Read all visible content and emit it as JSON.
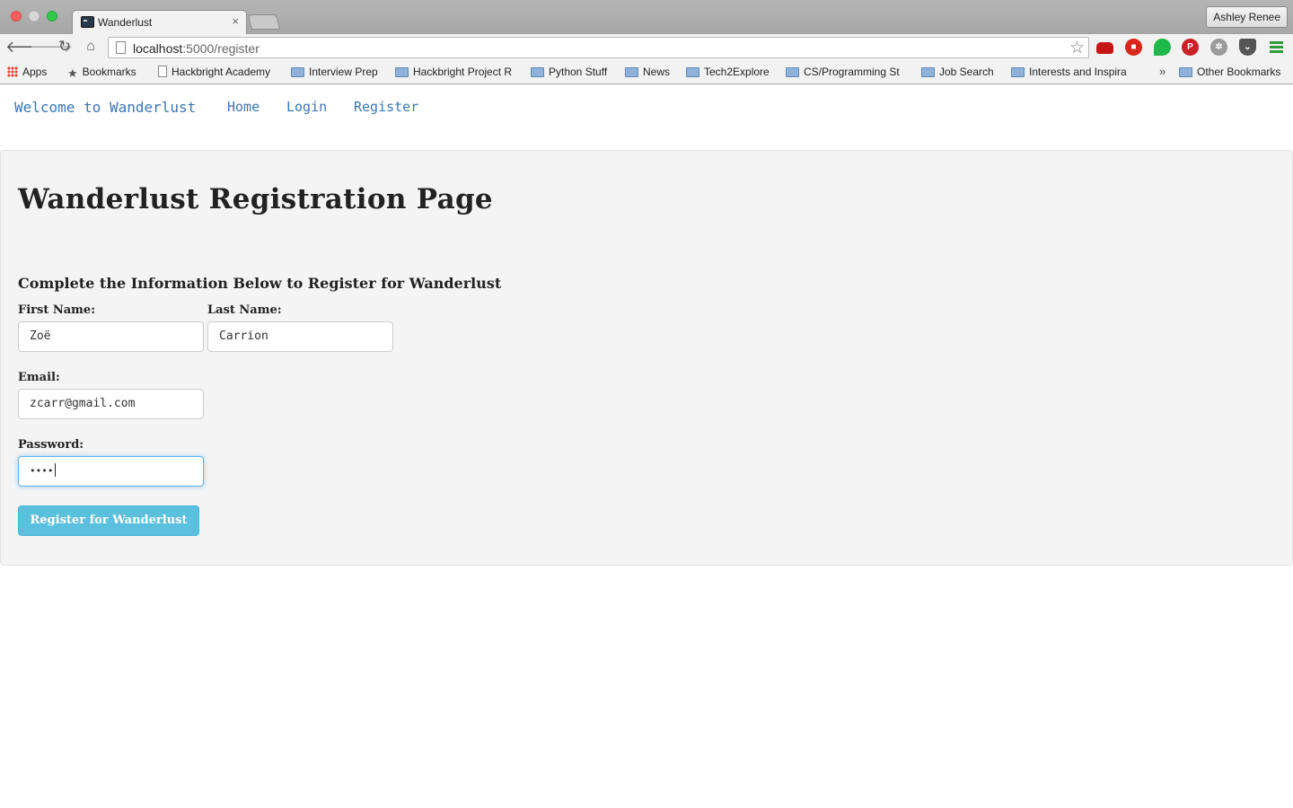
{
  "browser": {
    "tab_title": "Wanderlust",
    "tab_close": "×",
    "profile_name": "Ashley Renee",
    "url_host": "localhost",
    "url_path": ":5000/register",
    "bookmarks": [
      {
        "label": "Apps",
        "icon": "apps-icon"
      },
      {
        "label": "Bookmarks",
        "icon": "star-icon"
      },
      {
        "label": "Hackbright Academy",
        "icon": "file-icon"
      },
      {
        "label": "Interview Prep",
        "icon": "folder-icon"
      },
      {
        "label": "Hackbright Project R",
        "icon": "folder-icon"
      },
      {
        "label": "Python Stuff",
        "icon": "folder-icon"
      },
      {
        "label": "News",
        "icon": "folder-icon"
      },
      {
        "label": "Tech2Explore",
        "icon": "folder-icon"
      },
      {
        "label": "CS/Programming St",
        "icon": "folder-icon"
      },
      {
        "label": "Job Search",
        "icon": "folder-icon"
      },
      {
        "label": "Interests and Inspira",
        "icon": "folder-icon"
      }
    ],
    "bookmarks_overflow": "»",
    "other_bookmarks": "Other Bookmarks"
  },
  "navbar": {
    "brand": "Welcome to Wanderlust",
    "links": [
      "Home",
      "Login",
      "Register"
    ]
  },
  "form": {
    "title": "Wanderlust Registration Page",
    "subheading": "Complete the Information Below to Register for Wanderlust",
    "first_name_label": "First Name:",
    "first_name_value": "Zoë",
    "last_name_label": "Last Name:",
    "last_name_value": "Carrion",
    "email_label": "Email:",
    "email_value": "zcarr@gmail.com",
    "password_label": "Password:",
    "password_value": "••••",
    "submit_label": "Register for Wanderlust"
  },
  "colors": {
    "link": "#3d76b5",
    "button_info": "#5bc0de",
    "jumbotron_bg": "#f4f4f4",
    "focus_border": "#66afe9"
  }
}
